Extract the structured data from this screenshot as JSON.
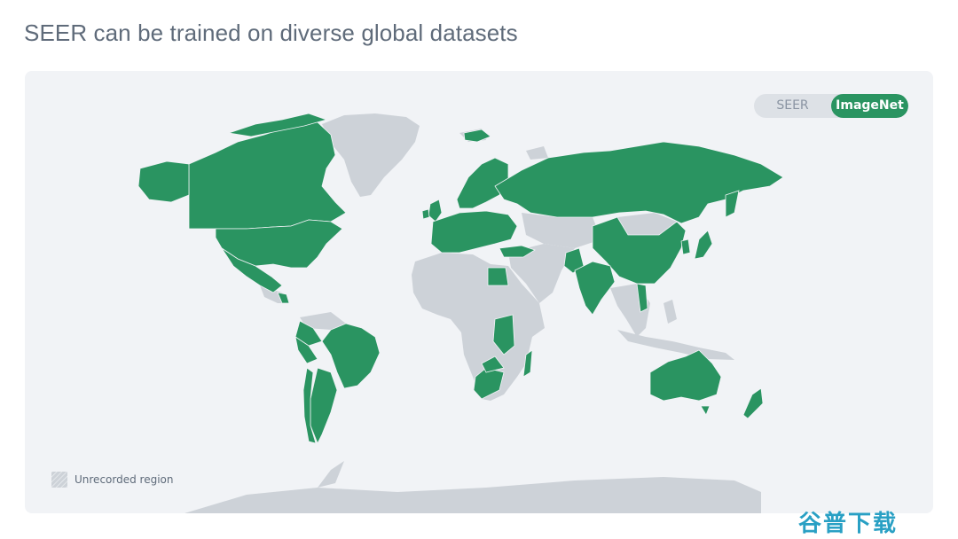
{
  "title": "SEER can be trained on diverse global datasets",
  "toggle": {
    "options": [
      "SEER",
      "ImageNet"
    ],
    "selected": "ImageNet"
  },
  "legend": {
    "label": "Unrecorded region"
  },
  "watermark": "谷普下载",
  "colors": {
    "recorded": "#2a9461",
    "unrecorded": "#cdd2d8",
    "background": "#f1f3f6",
    "title": "#5f6b7a"
  },
  "highlighted_regions": [
    "Canada",
    "United States",
    "Mexico",
    "Nicaragua",
    "Panama",
    "Colombia",
    "Brazil",
    "Peru",
    "Bolivia",
    "Paraguay",
    "Argentina",
    "Uruguay",
    "Chile",
    "Iceland",
    "Norway",
    "Sweden",
    "Finland",
    "United Kingdom",
    "Ireland",
    "France",
    "Spain",
    "Portugal",
    "Germany",
    "Poland",
    "Italy",
    "Greece",
    "Romania",
    "Ukraine",
    "Turkey",
    "Egypt",
    "Russia",
    "China",
    "Japan",
    "South Korea",
    "Pakistan",
    "India",
    "Nepal",
    "Bangladesh",
    "Vietnam",
    "Ethiopia",
    "Kenya",
    "Tanzania",
    "Zambia",
    "Zimbabwe",
    "Mozambique",
    "Madagascar",
    "South Africa",
    "Australia",
    "New Zealand"
  ]
}
